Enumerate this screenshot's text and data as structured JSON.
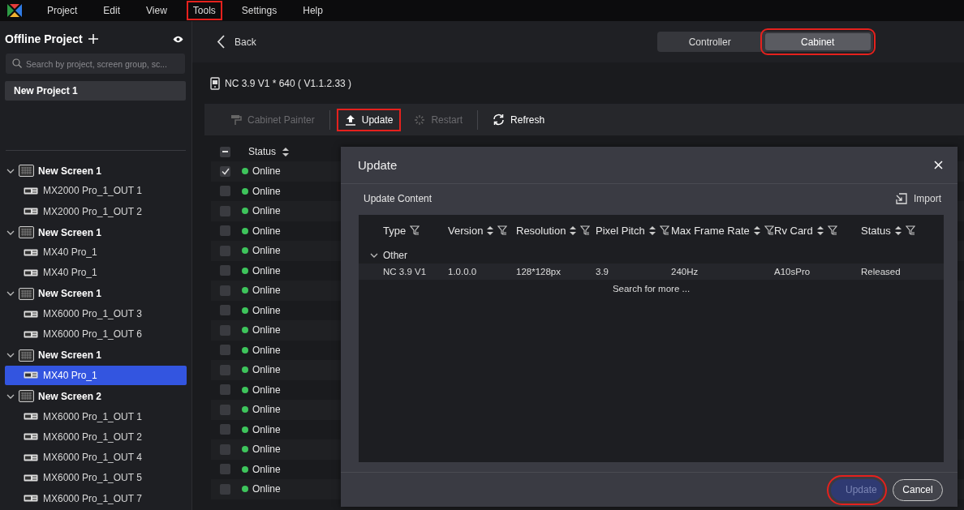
{
  "menu": [
    {
      "label": "Project",
      "highlighted": false
    },
    {
      "label": "Edit",
      "highlighted": false
    },
    {
      "label": "View",
      "highlighted": false
    },
    {
      "label": "Tools",
      "highlighted": true
    },
    {
      "label": "Settings",
      "highlighted": false
    },
    {
      "label": "Help",
      "highlighted": false
    }
  ],
  "sidebar": {
    "title": "Offline Project",
    "search": {
      "placeholder": "Search by project, screen group, sc..."
    },
    "project": "New Project 1",
    "screens": [
      {
        "name": "New Screen 1",
        "expanded": true,
        "children": [
          {
            "name": "MX2000 Pro_1_OUT 1",
            "selected": false
          },
          {
            "name": "MX2000 Pro_1_OUT 2",
            "selected": false
          }
        ]
      },
      {
        "name": "New Screen 1",
        "expanded": true,
        "children": [
          {
            "name": "MX40 Pro_1",
            "selected": false
          },
          {
            "name": "MX40 Pro_1",
            "selected": false
          }
        ]
      },
      {
        "name": "New Screen 1",
        "expanded": true,
        "children": [
          {
            "name": "MX6000 Pro_1_OUT 3",
            "selected": false
          },
          {
            "name": "MX6000 Pro_1_OUT 6",
            "selected": false
          }
        ]
      },
      {
        "name": "New Screen 1",
        "expanded": true,
        "children": [
          {
            "name": "MX40 Pro_1",
            "selected": true
          }
        ]
      },
      {
        "name": "New Screen 2",
        "expanded": true,
        "children": [
          {
            "name": "MX6000 Pro_1_OUT 1",
            "selected": false
          },
          {
            "name": "MX6000 Pro_1_OUT 2",
            "selected": false
          },
          {
            "name": "MX6000 Pro_1_OUT 4",
            "selected": false
          },
          {
            "name": "MX6000 Pro_1_OUT 5",
            "selected": false
          },
          {
            "name": "MX6000 Pro_1_OUT 7",
            "selected": false
          }
        ]
      }
    ]
  },
  "header": {
    "back": "Back",
    "tabs": [
      {
        "label": "Controller",
        "selected": false,
        "highlighted": false
      },
      {
        "label": "Cabinet",
        "selected": true,
        "highlighted": true
      }
    ]
  },
  "device": "NC 3.9 V1 * 640 ( V1.1.2.33 )",
  "toolbar": [
    {
      "label": "Cabinet Painter",
      "disabled": true,
      "highlighted": false
    },
    {
      "label": "Update",
      "disabled": false,
      "highlighted": true
    },
    {
      "label": "Restart",
      "disabled": true,
      "highlighted": false
    },
    {
      "label": "Refresh",
      "disabled": false,
      "highlighted": false
    }
  ],
  "table": {
    "select_all": {
      "indeterminate": true
    },
    "columns": [
      "Status"
    ],
    "rows": [
      {
        "checked": true,
        "status": "Online"
      },
      {
        "checked": false,
        "status": "Online"
      },
      {
        "checked": false,
        "status": "Online"
      },
      {
        "checked": false,
        "status": "Online"
      },
      {
        "checked": false,
        "status": "Online"
      },
      {
        "checked": false,
        "status": "Online"
      },
      {
        "checked": false,
        "status": "Online"
      },
      {
        "checked": false,
        "status": "Online"
      },
      {
        "checked": false,
        "status": "Online"
      },
      {
        "checked": false,
        "status": "Online"
      },
      {
        "checked": false,
        "status": "Online"
      },
      {
        "checked": false,
        "status": "Online"
      },
      {
        "checked": false,
        "status": "Online"
      },
      {
        "checked": false,
        "status": "Online"
      },
      {
        "checked": false,
        "status": "Online"
      },
      {
        "checked": false,
        "status": "Online"
      },
      {
        "checked": false,
        "status": "Online"
      }
    ]
  },
  "dialog": {
    "title": "Update",
    "section": "Update Content",
    "import": "Import",
    "columns": [
      {
        "label": "Type",
        "sortable": false
      },
      {
        "label": "Version",
        "sortable": true
      },
      {
        "label": "Resolution",
        "sortable": true
      },
      {
        "label": "Pixel Pitch",
        "sortable": true
      },
      {
        "label": "Max Frame Rate",
        "sortable": true
      },
      {
        "label": "Rv Card",
        "sortable": true
      },
      {
        "label": "Status",
        "sortable": true
      }
    ],
    "groups": [
      {
        "name": "Other",
        "expanded": true,
        "rows": [
          [
            "NC 3.9 V1",
            "1.0.0.0",
            "128*128px",
            "3.9",
            "240Hz",
            "A10sPro",
            "Released"
          ]
        ]
      }
    ],
    "more": "Search for more ...",
    "buttons": [
      {
        "label": "Update",
        "kind": "primary",
        "disabled": true,
        "highlighted": true
      },
      {
        "label": "Cancel",
        "kind": "secondary",
        "disabled": false,
        "highlighted": false
      }
    ]
  }
}
